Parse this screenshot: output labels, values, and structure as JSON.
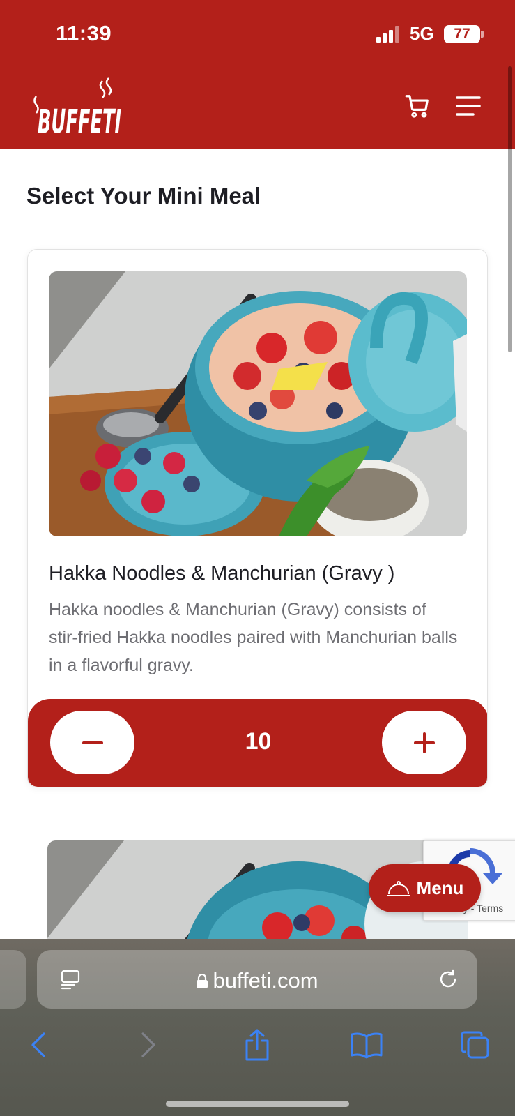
{
  "status_bar": {
    "time": "11:39",
    "network": "5G",
    "battery": "77"
  },
  "header": {
    "logo_text": "BUFFETI",
    "cart_icon": "cart-icon",
    "menu_icon": "hamburger-icon"
  },
  "page": {
    "title": "Select Your Mini Meal"
  },
  "items": [
    {
      "title": "Hakka Noodles & Manchurian (Gravy )",
      "description": "Hakka noodles & Manchurian (Gravy) consists of stir-fried Hakka noodles paired with Manchurian balls in a flavorful gravy.",
      "quantity": "10",
      "minus_icon": "minus-icon",
      "plus_icon": "plus-icon"
    }
  ],
  "recaptcha": {
    "terms": "Privacy - Terms"
  },
  "floating_menu": {
    "label": "Menu",
    "icon": "cloche-icon"
  },
  "browser": {
    "url": "buffeti.com"
  },
  "colors": {
    "brand_red": "#b3201a",
    "text_dark": "#1e1e24",
    "text_muted": "#6e6e73",
    "ios_blue": "#3b82f6"
  }
}
